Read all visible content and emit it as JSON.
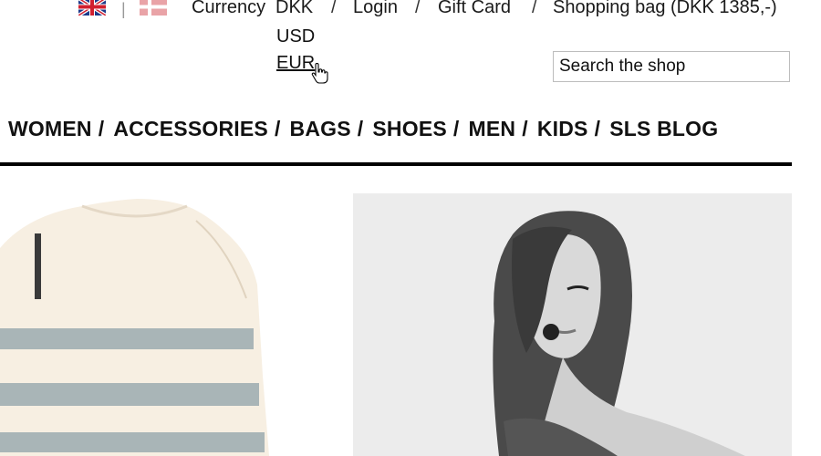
{
  "topbar": {
    "flags": [
      {
        "name": "uk-flag-icon",
        "colors": [
          "#1d3a8a",
          "#ffffff",
          "#d11f2f"
        ]
      },
      {
        "name": "denmark-flag-icon",
        "colors": [
          "#e9a3a7",
          "#ffffff"
        ]
      }
    ],
    "flag_separator": "|",
    "currency_label": "Currency",
    "currency_value": "DKK",
    "login": "Login",
    "gift_card": "Gift Card",
    "shopping_bag": "Shopping bag (DKK 1385,-)",
    "separator": "/"
  },
  "currency_dropdown": {
    "options": [
      "USD",
      "EUR"
    ],
    "hovered": "EUR"
  },
  "search": {
    "placeholder": "Search the shop"
  },
  "nav": {
    "items": [
      "WOMEN",
      "ACCESSORIES",
      "BAGS",
      "SHOES",
      "MEN",
      "KIDS",
      "SLS BLOG"
    ],
    "separator": "/"
  },
  "images": {
    "product": "striped-sweater-image",
    "model": "tattooed-model-photo"
  },
  "colors": {
    "text": "#111111",
    "rule": "#000000",
    "sweater": "#f7efe2",
    "stripes": "#a9b5b7"
  }
}
